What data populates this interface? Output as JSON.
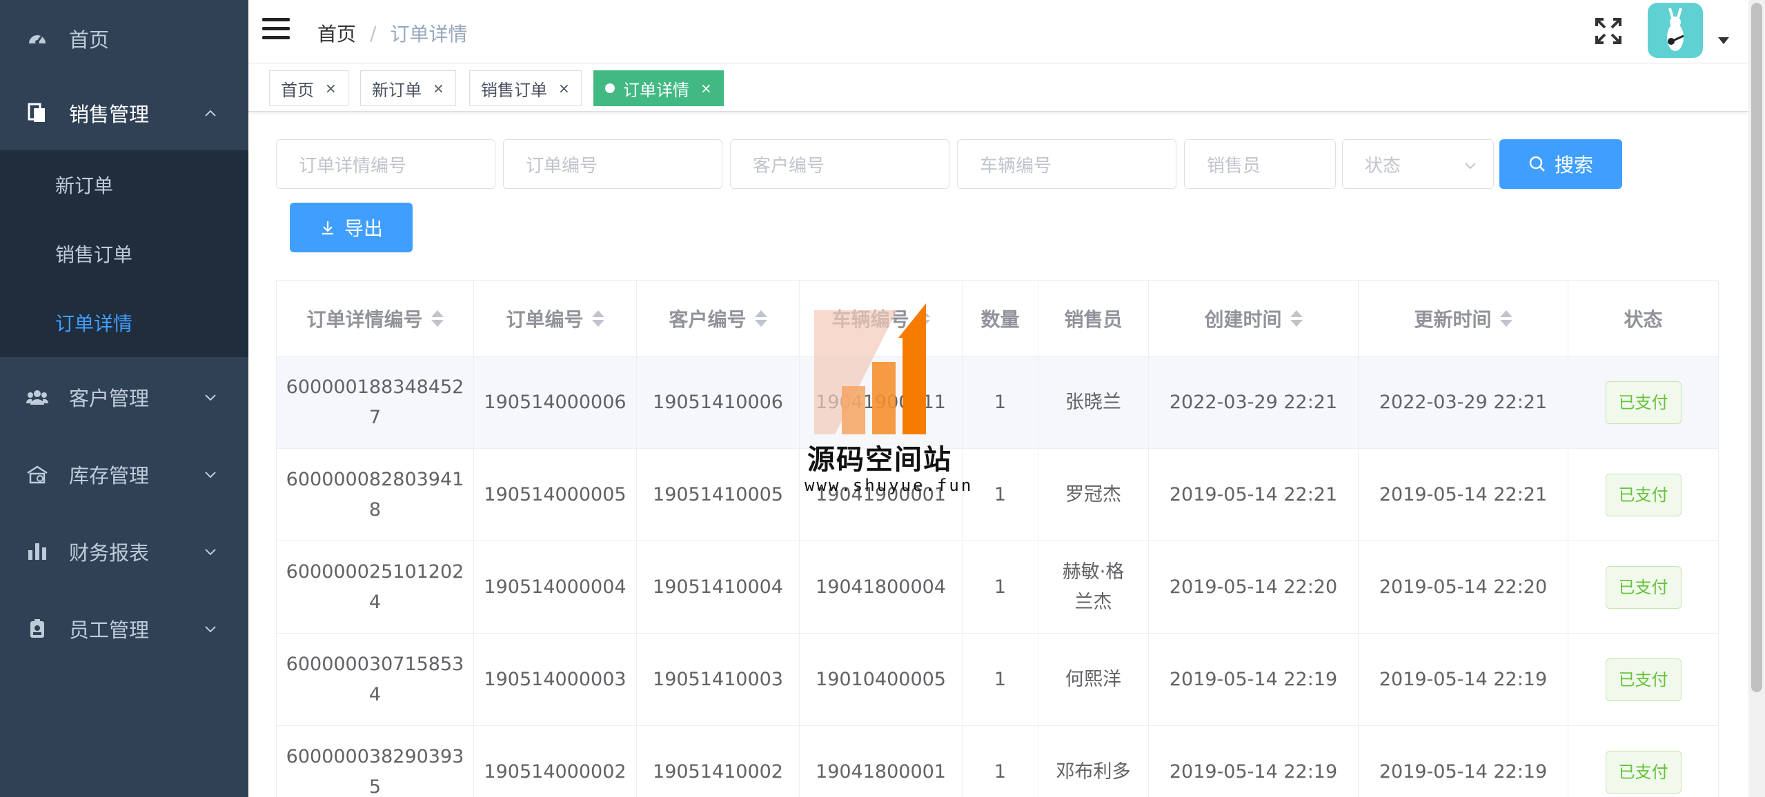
{
  "sidebar": {
    "items": [
      {
        "label": "首页",
        "icon": "dashboard-icon"
      },
      {
        "label": "销售管理",
        "icon": "document-icon"
      },
      {
        "label": "客户管理",
        "icon": "users-icon"
      },
      {
        "label": "库存管理",
        "icon": "warehouse-icon"
      },
      {
        "label": "财务报表",
        "icon": "bar-chart-icon"
      },
      {
        "label": "员工管理",
        "icon": "id-badge-icon"
      }
    ],
    "sub_items": [
      {
        "label": "新订单"
      },
      {
        "label": "销售订单"
      },
      {
        "label": "订单详情"
      }
    ],
    "active_sub": "订单详情"
  },
  "navbar": {
    "breadcrumb": [
      "首页",
      "订单详情"
    ],
    "separator": "/"
  },
  "tags": [
    {
      "label": "首页",
      "close": "×"
    },
    {
      "label": "新订单",
      "close": "×"
    },
    {
      "label": "销售订单",
      "close": "×"
    },
    {
      "label": "订单详情",
      "close": "×"
    }
  ],
  "filters": {
    "order_detail_no": "订单详情编号",
    "order_no": "订单编号",
    "customer_no": "客户编号",
    "vehicle_no": "车辆编号",
    "salesperson": "销售员",
    "status": "状态",
    "search_label": "搜索",
    "export_label": "导出"
  },
  "table": {
    "headers": [
      "订单详情编号",
      "订单编号",
      "客户编号",
      "车辆编号",
      "数量",
      "销售员",
      "创建时间",
      "更新时间",
      "状态"
    ],
    "rows": [
      {
        "detail_line1": "600000188348452",
        "detail_line2": "7",
        "order": "190514000006",
        "customer": "19051410006",
        "vehicle": "19041900011",
        "qty": "1",
        "sales": "张晓兰",
        "created": "2022-03-29 22:21",
        "updated": "2022-03-29 22:21",
        "status": "已支付"
      },
      {
        "detail_line1": "600000082803941",
        "detail_line2": "8",
        "order": "190514000005",
        "customer": "19051410005",
        "vehicle": "19041900001",
        "qty": "1",
        "sales": "罗冠杰",
        "created": "2019-05-14 22:21",
        "updated": "2019-05-14 22:21",
        "status": "已支付"
      },
      {
        "detail_line1": "600000025101202",
        "detail_line2": "4",
        "order": "190514000004",
        "customer": "19051410004",
        "vehicle": "19041800004",
        "qty": "1",
        "sales": "赫敏·格兰杰",
        "created": "2019-05-14 22:20",
        "updated": "2019-05-14 22:20",
        "status": "已支付"
      },
      {
        "detail_line1": "600000030715853",
        "detail_line2": "4",
        "order": "190514000003",
        "customer": "19051410003",
        "vehicle": "19010400005",
        "qty": "1",
        "sales": "何熙洋",
        "created": "2019-05-14 22:19",
        "updated": "2019-05-14 22:19",
        "status": "已支付"
      },
      {
        "detail_line1": "600000038290393",
        "detail_line2": "5",
        "order": "190514000002",
        "customer": "19051410002",
        "vehicle": "19041800001",
        "qty": "1",
        "sales": "邓布利多",
        "created": "2019-05-14 22:19",
        "updated": "2019-05-14 22:19",
        "status": "已支付"
      }
    ]
  },
  "watermark": {
    "title": "源码空间站",
    "url": "www.shuyue.fun"
  },
  "colors": {
    "sidebar_bg": "#304156",
    "accent": "#409eff",
    "tag_active": "#42b983",
    "success": "#67c23a"
  }
}
